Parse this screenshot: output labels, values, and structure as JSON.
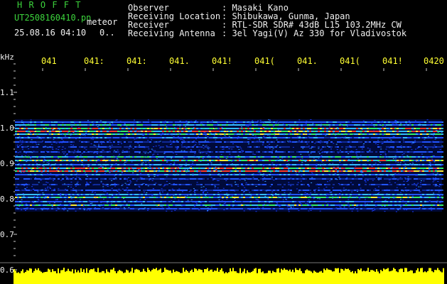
{
  "header": {
    "brand": "H R O F F T",
    "filename": "UT2508160410.pn",
    "mode": "meteor",
    "datetime": "25.08.16 04:10",
    "count": "0..",
    "info": [
      {
        "label": "Observer",
        "value": ": Masaki Kano"
      },
      {
        "label": "Receiving Location",
        "value": ": Shibukawa, Gunma, Japan"
      },
      {
        "label": "Receiver",
        "value": ": RTL-SDR SDR# 43dB L15 103.2MHz CW"
      },
      {
        "label": "Receiving Antenna",
        "value": ": 3el Yagi(V) Az 330 for Vladivostok"
      }
    ]
  },
  "time_axis": {
    "ticks": [
      "041",
      "041:",
      "041:",
      "041.",
      "041!",
      "041(",
      "041.",
      "041(",
      "041!",
      "0420"
    ]
  },
  "freq_axis": {
    "unit": "kHz",
    "labels": [
      "1.1",
      "1.0",
      "0.9",
      "0.8",
      "0.7",
      "0.6"
    ]
  },
  "colors": {
    "header_green": "#3cd43c",
    "text_white": "#f0f0f0",
    "tick_yellow": "#ffff33",
    "noise_blue": "#1a3cff",
    "signal_red": "#ff3030"
  }
}
